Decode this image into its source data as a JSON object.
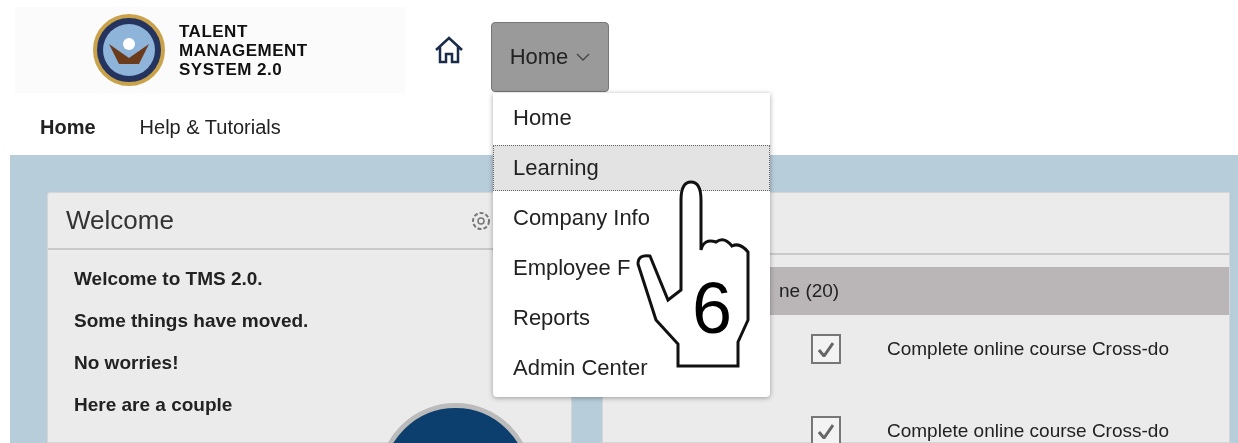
{
  "logo": {
    "lines": [
      "TALENT",
      "MANAGEMENT",
      "SYSTEM 2.0"
    ]
  },
  "menu_button": {
    "label": "Home",
    "expanded": true
  },
  "dropdown": [
    {
      "label": "Home",
      "selected": false
    },
    {
      "label": "Learning",
      "selected": true
    },
    {
      "label": "Company Info",
      "selected": false
    },
    {
      "label": "Employee F",
      "selected": false
    },
    {
      "label": "Reports",
      "selected": false
    },
    {
      "label": "Admin Center",
      "selected": false
    }
  ],
  "nav": [
    {
      "label": "Home",
      "selected": true
    },
    {
      "label": "Help & Tutorials",
      "selected": false
    }
  ],
  "welcome": {
    "title": "Welcome",
    "lines": [
      "Welcome to TMS 2.0.",
      "Some things have moved.",
      "No worries!",
      "Here are a couple"
    ]
  },
  "todo": {
    "group": "ne (20)",
    "items": [
      {
        "label": "Complete online course Cross-do",
        "checked": true
      },
      {
        "label": "Complete online course Cross-do",
        "checked": true
      }
    ]
  },
  "callout": {
    "step": "6"
  }
}
